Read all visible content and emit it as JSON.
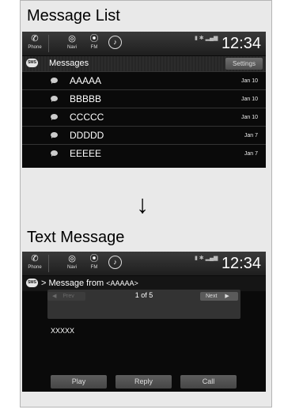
{
  "sections": {
    "list_title": "Message List",
    "detail_title": "Text Message"
  },
  "statusbar": {
    "phone_label": "Phone",
    "navi_label": "Navi",
    "fm_label": "FM",
    "time": "12:34"
  },
  "list_screen": {
    "badge": "SMS",
    "title": "Messages",
    "settings_label": "Settings",
    "messages": [
      {
        "name": "AAAAA",
        "date": "Jan 10"
      },
      {
        "name": "BBBBB",
        "date": "Jan 10"
      },
      {
        "name": "CCCCC",
        "date": "Jan 10"
      },
      {
        "name": "DDDDD",
        "date": "Jan 7"
      },
      {
        "name": "EEEEE",
        "date": "Jan 7"
      }
    ]
  },
  "detail_screen": {
    "badge": "SMS",
    "title_prefix": "> Message from",
    "title_sender": "<AAAAA>",
    "prev_label": "Prev",
    "counter_current": "1",
    "counter_of": "of",
    "counter_total": "5",
    "next_label": "Next",
    "body": "XXXXX",
    "buttons": {
      "play": "Play",
      "reply": "Reply",
      "call": "Call"
    }
  },
  "colors": {
    "screen_bg": "#0a0a0a",
    "panel_bg": "#e9e9e9"
  }
}
